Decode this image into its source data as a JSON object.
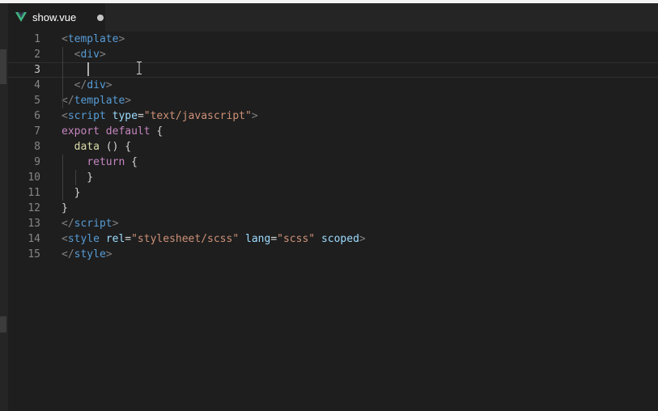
{
  "tab": {
    "title": "show.vue",
    "icon": "vue-logo-icon",
    "modified": true
  },
  "colors": {
    "editor_bg": "#1e1e1e",
    "tabbar_bg": "#252526",
    "vue_green": "#41b883",
    "tag": "#569cd6",
    "attr": "#9cdcfe",
    "string": "#ce9178",
    "keyword": "#c586c0",
    "function": "#dcdcaa"
  },
  "cursor": {
    "line": 3
  },
  "lines": [
    {
      "n": "1",
      "parts": [
        [
          "punc",
          "<"
        ],
        [
          "tag",
          "template"
        ],
        [
          "punc",
          ">"
        ]
      ]
    },
    {
      "n": "2",
      "parts": [
        [
          "txt",
          "  "
        ],
        [
          "punc",
          "<"
        ],
        [
          "tag",
          "div"
        ],
        [
          "punc",
          ">"
        ]
      ]
    },
    {
      "n": "3",
      "parts": []
    },
    {
      "n": "4",
      "parts": [
        [
          "txt",
          "  "
        ],
        [
          "punc",
          "</"
        ],
        [
          "tag",
          "div"
        ],
        [
          "punc",
          ">"
        ]
      ]
    },
    {
      "n": "5",
      "parts": [
        [
          "punc",
          "</"
        ],
        [
          "tag",
          "template"
        ],
        [
          "punc",
          ">"
        ]
      ]
    },
    {
      "n": "6",
      "parts": [
        [
          "punc",
          "<"
        ],
        [
          "tag",
          "script"
        ],
        [
          "txt",
          " "
        ],
        [
          "attr",
          "type"
        ],
        [
          "txt",
          "="
        ],
        [
          "str",
          "\"text/javascript\""
        ],
        [
          "punc",
          ">"
        ]
      ]
    },
    {
      "n": "7",
      "parts": [
        [
          "kw",
          "export"
        ],
        [
          "txt",
          " "
        ],
        [
          "kw",
          "default"
        ],
        [
          "txt",
          " {"
        ]
      ]
    },
    {
      "n": "8",
      "parts": [
        [
          "txt",
          "  "
        ],
        [
          "fn",
          "data"
        ],
        [
          "txt",
          " () {"
        ]
      ]
    },
    {
      "n": "9",
      "parts": [
        [
          "txt",
          "    "
        ],
        [
          "kw",
          "return"
        ],
        [
          "txt",
          " {"
        ]
      ]
    },
    {
      "n": "10",
      "parts": [
        [
          "txt",
          "    }"
        ]
      ]
    },
    {
      "n": "11",
      "parts": [
        [
          "txt",
          "  }"
        ]
      ]
    },
    {
      "n": "12",
      "parts": [
        [
          "txt",
          "}"
        ]
      ]
    },
    {
      "n": "13",
      "parts": [
        [
          "punc",
          "</"
        ],
        [
          "tag",
          "script"
        ],
        [
          "punc",
          ">"
        ]
      ]
    },
    {
      "n": "14",
      "parts": [
        [
          "punc",
          "<"
        ],
        [
          "tag",
          "style"
        ],
        [
          "txt",
          " "
        ],
        [
          "attr",
          "rel"
        ],
        [
          "txt",
          "="
        ],
        [
          "str",
          "\"stylesheet/scss\""
        ],
        [
          "txt",
          " "
        ],
        [
          "attr",
          "lang"
        ],
        [
          "txt",
          "="
        ],
        [
          "str",
          "\"scss\""
        ],
        [
          "txt",
          " "
        ],
        [
          "attr",
          "scoped"
        ],
        [
          "punc",
          ">"
        ]
      ]
    },
    {
      "n": "15",
      "parts": [
        [
          "punc",
          "</"
        ],
        [
          "tag",
          "style"
        ],
        [
          "punc",
          ">"
        ]
      ]
    }
  ]
}
